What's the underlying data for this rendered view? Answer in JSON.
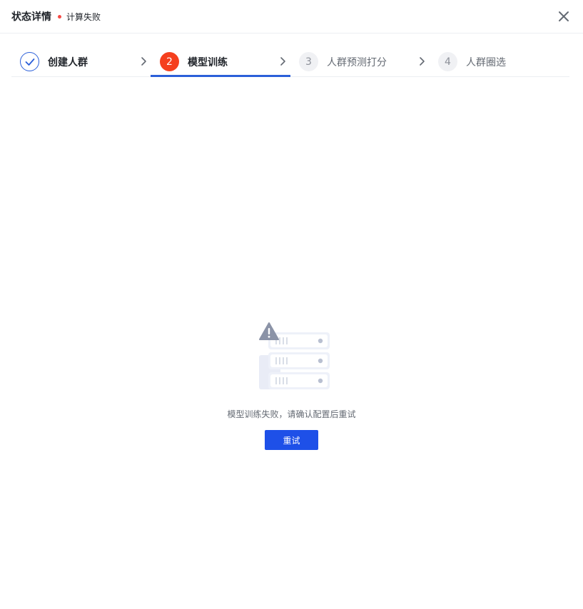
{
  "header": {
    "title": "状态详情",
    "status_text": "计算失败",
    "status_color": "#f54a45"
  },
  "steps": [
    {
      "index": "1",
      "label": "创建人群",
      "state": "done",
      "icon": "check-icon"
    },
    {
      "index": "2",
      "label": "模型训练",
      "state": "error"
    },
    {
      "index": "3",
      "label": "人群预测打分",
      "state": "wait"
    },
    {
      "index": "4",
      "label": "人群圈选",
      "state": "wait"
    }
  ],
  "active_step": 2,
  "empty_state": {
    "icon": "server-warning-illustration",
    "message": "模型训练失败，请确认配置后重试",
    "retry_label": "重试"
  },
  "colors": {
    "primary": "#1e50e8",
    "error": "#f53f1e",
    "active_underline": "#2b5fd9"
  }
}
